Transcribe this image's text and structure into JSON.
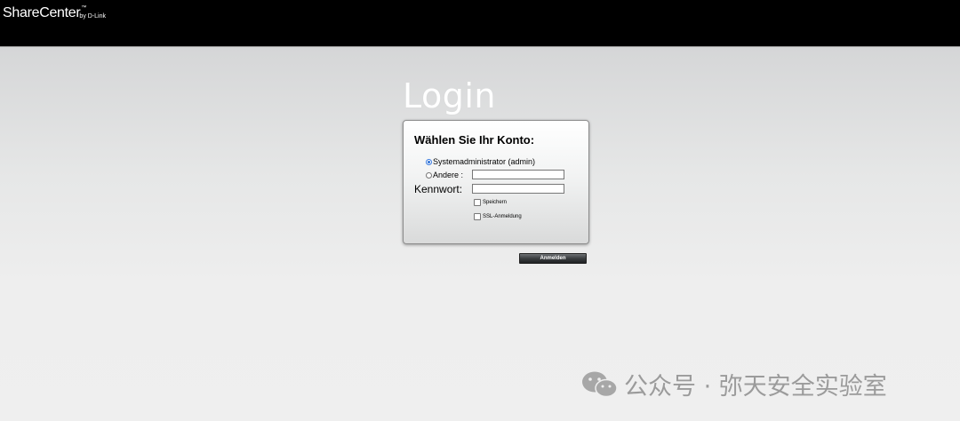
{
  "header": {
    "brand_name": "ShareCenter",
    "brand_tm": "™",
    "brand_sub": "by D-Link"
  },
  "login": {
    "title": "Login",
    "heading": "Wählen Sie Ihr Konto:",
    "option_admin": "Systemadministrator (admin)",
    "option_other": "Andere :",
    "other_value": "",
    "password_label": "Kennwort:",
    "password_value": "",
    "save_label": "Speichern",
    "ssl_label": "SSL-Anmeldung",
    "submit_label": "Anmelden"
  },
  "watermark": {
    "icon": "wechat-icon",
    "text": "公众号 · 弥天安全实验室"
  },
  "colors": {
    "topbar": "#000000",
    "radio_accent": "#2b6fd6",
    "button_dark": "#2f3234",
    "watermark": "#9b9b9b"
  }
}
